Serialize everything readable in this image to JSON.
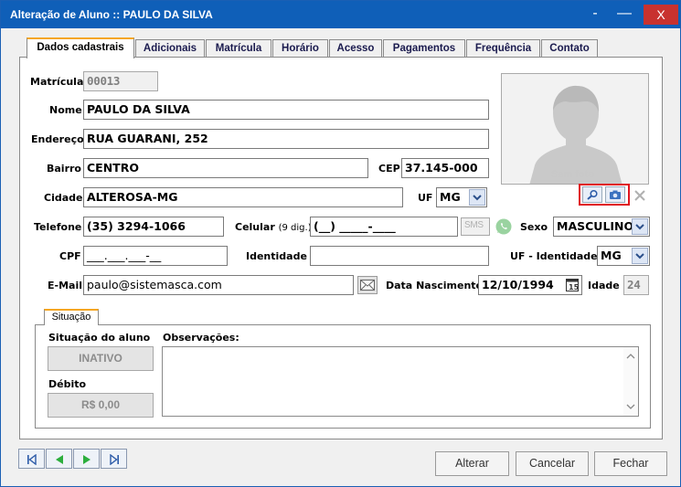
{
  "window": {
    "title": "Alteração de Aluno :: PAULO DA SILVA",
    "minimize_a": "-",
    "minimize_b": "—",
    "close": "X"
  },
  "tabs": [
    {
      "label": "Dados cadastrais"
    },
    {
      "label": "Adicionais"
    },
    {
      "label": "Matrícula"
    },
    {
      "label": "Horário"
    },
    {
      "label": "Acesso"
    },
    {
      "label": "Pagamentos"
    },
    {
      "label": "Frequência"
    },
    {
      "label": "Contato"
    }
  ],
  "form": {
    "matricula": {
      "label": "Matrícula",
      "value": "00013"
    },
    "nome": {
      "label": "Nome",
      "value": "PAULO DA SILVA"
    },
    "endereco": {
      "label": "Endereço",
      "value": "RUA GUARANI, 252"
    },
    "bairro": {
      "label": "Bairro",
      "value": "CENTRO"
    },
    "cep": {
      "label": "CEP",
      "value": "37.145-000"
    },
    "cidade": {
      "label": "Cidade",
      "value": "ALTEROSA-MG"
    },
    "uf": {
      "label": "UF",
      "value": "MG"
    },
    "telefone": {
      "label": "Telefone",
      "value": "(35) 3294-1066"
    },
    "celular": {
      "label": "Celular",
      "hint": "(9 dig.)",
      "value": "(__) _____-____"
    },
    "sms": "SMS",
    "sexo": {
      "label": "Sexo",
      "value": "MASCULINO"
    },
    "cpf": {
      "label": "CPF",
      "value": "___.___.___-__"
    },
    "identidade": {
      "label": "Identidade",
      "value": ""
    },
    "uf_identidade": {
      "label": "UF - Identidade",
      "value": "MG"
    },
    "email": {
      "label": "E-Mail",
      "value": "paulo@sistemasca.com"
    },
    "data_nascimento": {
      "label": "Data Nascimento",
      "value": "12/10/1994"
    },
    "idade": {
      "label": "Idade",
      "value": "24"
    }
  },
  "photo": {
    "caption": "Sem foto"
  },
  "situacao": {
    "tab_label": "Situação",
    "status_label": "Situação do aluno",
    "status_value": "INATIVO",
    "debito_label": "Débito",
    "debito_value": "R$ 0,00",
    "observacoes_label": "Observações:",
    "observacoes_value": ""
  },
  "buttons": {
    "alterar": "Alterar",
    "cancelar": "Cancelar",
    "fechar": "Fechar"
  },
  "colors": {
    "titlebar": "#0f5fb8",
    "close": "#c8322f",
    "tab_accent": "#f5a623",
    "highlight": "#e0141e"
  }
}
